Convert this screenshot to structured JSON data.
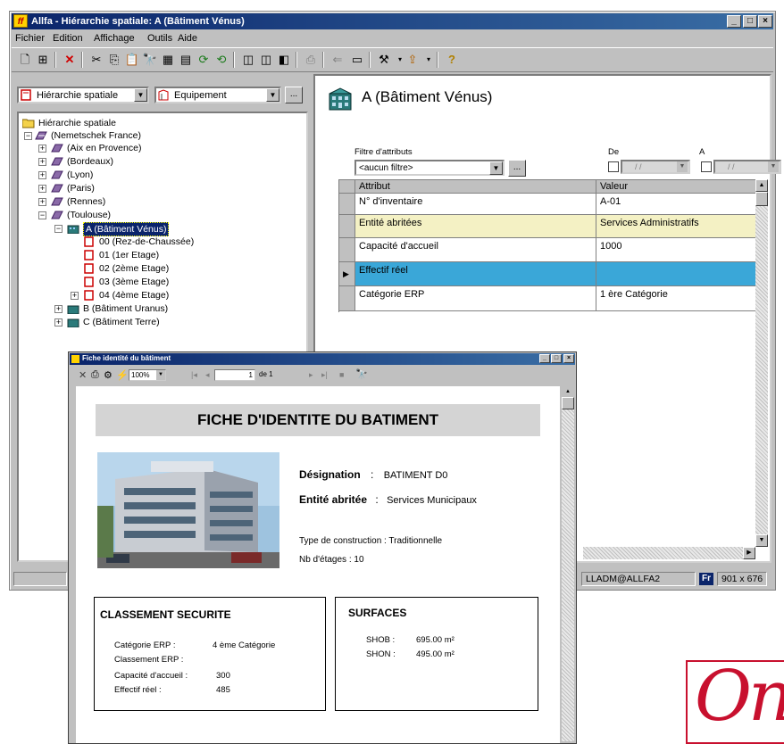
{
  "window": {
    "title": "Allfa - Hiérarchie spatiale: A (Bâtiment Vénus)",
    "app_icon": "ff-logo-icon",
    "controls": [
      "_",
      "□",
      "×"
    ]
  },
  "menu": [
    "Fichier",
    "Edition",
    "Affichage",
    "Outils",
    "Aide"
  ],
  "left": {
    "view_combo": "Hiérarchie spatiale",
    "type_combo": "Equipement",
    "more_btn": "..."
  },
  "tree": {
    "root": "Hiérarchie spatiale",
    "company": "(Nemetschek France)",
    "cities": [
      "(Aix en Provence)",
      "(Bordeaux)",
      "(Lyon)",
      "(Paris)",
      "(Rennes)",
      "(Toulouse)"
    ],
    "building_selected": "A (Bâtiment Vénus)",
    "floors": [
      "00 (Rez-de-Chaussée)",
      "01 (1er Etage)",
      "02 (2ème Etage)",
      "03 (3ème Etage)",
      "04 (4ème Etage)"
    ],
    "buildings_other": [
      "B (Bâtiment Uranus)",
      "C (Bâtiment Terre)"
    ]
  },
  "detail": {
    "heading": "A (Bâtiment Vénus)",
    "filter_label": "Filtre d'attributs",
    "filter_value": "<aucun filtre>",
    "filter_btn": "...",
    "from_label": "De",
    "to_label": "A",
    "date_placeholder": "/ /",
    "columns": [
      "Attribut",
      "Valeur"
    ],
    "rows": [
      {
        "attr": "N° d'inventaire",
        "value": "A-01"
      },
      {
        "attr": "Entité abritées",
        "value": "Services Administratifs"
      },
      {
        "attr": "Capacité d'accueil",
        "value": "1000"
      },
      {
        "attr": "Effectif réel",
        "value": ""
      },
      {
        "attr": "Catégorie ERP",
        "value": "1 ère Catégorie"
      }
    ]
  },
  "status": {
    "user": "LLADM@ALLFA2",
    "lang": "Fr",
    "resolution": "901 x 676"
  },
  "report": {
    "title": "Fiche identité du bâtiment",
    "zoom": "100%",
    "page_num": "1",
    "page_of": "de 1",
    "heading": "FICHE D'IDENTITE DU BATIMENT",
    "designation_label": "Désignation",
    "designation_value": "BATIMENT D0",
    "entity_label": "Entité abritée",
    "entity_value": "Services Municipaux",
    "construction": "Type de construction : Traditionnelle",
    "floors": "Nb d'étages : 10",
    "security": {
      "title": "CLASSEMENT SECURITE",
      "rows": [
        {
          "label": "Catégorie ERP :",
          "value": "4 ème Catégorie"
        },
        {
          "label": "Classement ERP :",
          "value": ""
        },
        {
          "label": "Capacité d'accueil :",
          "value": "300"
        },
        {
          "label": "Effectif réel :",
          "value": "485"
        }
      ]
    },
    "surfaces": {
      "title": "SURFACES",
      "rows": [
        {
          "label": "SHOB :",
          "value": "695.00 m²"
        },
        {
          "label": "SHON :",
          "value": "495.00 m²"
        }
      ]
    }
  },
  "logo_text": "On",
  "colors": {
    "title_bar": "#0a246a",
    "selected_row": "#3aa7d8",
    "highlight_row": "#f4f1c4",
    "logo_red": "#c8102e"
  }
}
